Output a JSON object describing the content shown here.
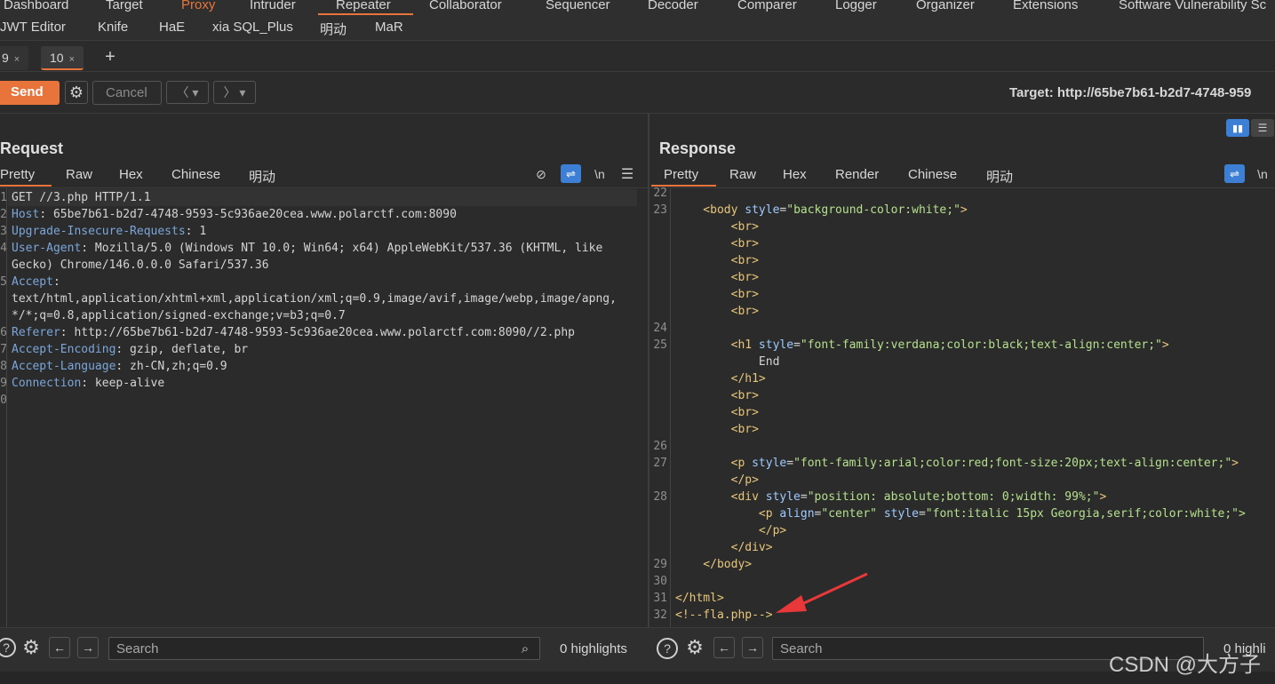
{
  "top_tabs": [
    "Dashboard",
    "Target",
    "Proxy",
    "Intruder",
    "Repeater",
    "Collaborator",
    "Sequencer",
    "Decoder",
    "Comparer",
    "Logger",
    "Organizer",
    "Extensions",
    "Software Vulnerability Sc"
  ],
  "ext_tabs": [
    "JWT Editor",
    "Knife",
    "HaE",
    "xia SQL_Plus",
    "明动",
    "MaR"
  ],
  "repeater_tabs": [
    {
      "label": "9"
    },
    {
      "label": "10"
    }
  ],
  "toolbar": {
    "send": "Send",
    "cancel": "Cancel",
    "target": "Target: http://65be7b61-b2d7-4748-959"
  },
  "request": {
    "title": "Request",
    "tabs": [
      "Pretty",
      "Raw",
      "Hex",
      "Chinese",
      "明动"
    ],
    "lines": [
      {
        "n": "1",
        "parts": [
          {
            "t": "GET //3.php HTTP/1.1",
            "c": "txt"
          }
        ]
      },
      {
        "n": "2",
        "parts": [
          {
            "t": "Host",
            "c": "k"
          },
          {
            "t": ": 65be7b61-b2d7-4748-9593-5c936ae20cea.www.polarctf.com:8090",
            "c": "txt"
          }
        ]
      },
      {
        "n": "3",
        "parts": [
          {
            "t": "Upgrade-Insecure-Requests",
            "c": "k"
          },
          {
            "t": ": 1",
            "c": "txt"
          }
        ]
      },
      {
        "n": "4",
        "parts": [
          {
            "t": "User-Agent",
            "c": "k"
          },
          {
            "t": ": Mozilla/5.0 (Windows NT 10.0; Win64; x64) AppleWebKit/537.36 (KHTML, like",
            "c": "txt"
          }
        ]
      },
      {
        "n": "",
        "parts": [
          {
            "t": "Gecko) Chrome/146.0.0.0 Safari/537.36",
            "c": "txt"
          }
        ]
      },
      {
        "n": "5",
        "parts": [
          {
            "t": "Accept",
            "c": "k"
          },
          {
            "t": ":",
            "c": "txt"
          }
        ]
      },
      {
        "n": "",
        "parts": [
          {
            "t": "text/html,application/xhtml+xml,application/xml;q=0.9,image/avif,image/webp,image/apng,",
            "c": "txt"
          }
        ]
      },
      {
        "n": "",
        "parts": [
          {
            "t": "*/*;q=0.8,application/signed-exchange;v=b3;q=0.7",
            "c": "txt"
          }
        ]
      },
      {
        "n": "6",
        "parts": [
          {
            "t": "Referer",
            "c": "k"
          },
          {
            "t": ": http://65be7b61-b2d7-4748-9593-5c936ae20cea.www.polarctf.com:8090//2.php",
            "c": "txt"
          }
        ]
      },
      {
        "n": "7",
        "parts": [
          {
            "t": "Accept-Encoding",
            "c": "k"
          },
          {
            "t": ": gzip, deflate, br",
            "c": "txt"
          }
        ]
      },
      {
        "n": "8",
        "parts": [
          {
            "t": "Accept-Language",
            "c": "k"
          },
          {
            "t": ": zh-CN,zh;q=0.9",
            "c": "txt"
          }
        ]
      },
      {
        "n": "9",
        "parts": [
          {
            "t": "Connection",
            "c": "k"
          },
          {
            "t": ": keep-alive",
            "c": "txt"
          }
        ]
      },
      {
        "n": "10",
        "parts": []
      }
    ]
  },
  "response": {
    "title": "Response",
    "tabs": [
      "Pretty",
      "Raw",
      "Hex",
      "Render",
      "Chinese",
      "明动"
    ],
    "lines": [
      {
        "n": "22",
        "parts": []
      },
      {
        "n": "23",
        "parts": [
          {
            "t": "    <body ",
            "c": "tag"
          },
          {
            "t": "style",
            "c": "attr"
          },
          {
            "t": "=",
            "c": "txt"
          },
          {
            "t": "\"background-color:white;\"",
            "c": "sval"
          },
          {
            "t": ">",
            "c": "tag"
          }
        ]
      },
      {
        "n": "",
        "parts": [
          {
            "t": "        <br>",
            "c": "tag"
          }
        ]
      },
      {
        "n": "",
        "parts": [
          {
            "t": "        <br>",
            "c": "tag"
          }
        ]
      },
      {
        "n": "",
        "parts": [
          {
            "t": "        <br>",
            "c": "tag"
          }
        ]
      },
      {
        "n": "",
        "parts": [
          {
            "t": "        <br>",
            "c": "tag"
          }
        ]
      },
      {
        "n": "",
        "parts": [
          {
            "t": "        <br>",
            "c": "tag"
          }
        ]
      },
      {
        "n": "",
        "parts": [
          {
            "t": "        <br>",
            "c": "tag"
          }
        ]
      },
      {
        "n": "24",
        "parts": []
      },
      {
        "n": "25",
        "parts": [
          {
            "t": "        <h1 ",
            "c": "tag"
          },
          {
            "t": "style",
            "c": "attr"
          },
          {
            "t": "=",
            "c": "txt"
          },
          {
            "t": "\"font-family:verdana;color:black;text-align:center;\"",
            "c": "sval"
          },
          {
            "t": ">",
            "c": "tag"
          }
        ]
      },
      {
        "n": "",
        "parts": [
          {
            "t": "            End",
            "c": "txt"
          }
        ]
      },
      {
        "n": "",
        "parts": [
          {
            "t": "        </h1>",
            "c": "tag"
          }
        ]
      },
      {
        "n": "",
        "parts": [
          {
            "t": "        <br>",
            "c": "tag"
          }
        ]
      },
      {
        "n": "",
        "parts": [
          {
            "t": "        <br>",
            "c": "tag"
          }
        ]
      },
      {
        "n": "",
        "parts": [
          {
            "t": "        <br>",
            "c": "tag"
          }
        ]
      },
      {
        "n": "26",
        "parts": []
      },
      {
        "n": "27",
        "parts": [
          {
            "t": "        <p ",
            "c": "tag"
          },
          {
            "t": "style",
            "c": "attr"
          },
          {
            "t": "=",
            "c": "txt"
          },
          {
            "t": "\"font-family:arial;color:red;font-size:20px;text-align:center;\"",
            "c": "sval"
          },
          {
            "t": ">",
            "c": "tag"
          }
        ]
      },
      {
        "n": "",
        "parts": [
          {
            "t": "        </p>",
            "c": "tag"
          }
        ]
      },
      {
        "n": "28",
        "parts": [
          {
            "t": "        <div ",
            "c": "tag"
          },
          {
            "t": "style",
            "c": "attr"
          },
          {
            "t": "=",
            "c": "txt"
          },
          {
            "t": "\"position: absolute;bottom: 0;width: 99%;\"",
            "c": "sval"
          },
          {
            "t": ">",
            "c": "tag"
          }
        ]
      },
      {
        "n": "",
        "parts": [
          {
            "t": "            <p ",
            "c": "tag"
          },
          {
            "t": "align",
            "c": "attr"
          },
          {
            "t": "=",
            "c": "txt"
          },
          {
            "t": "\"center\" ",
            "c": "sval"
          },
          {
            "t": "style",
            "c": "attr"
          },
          {
            "t": "=",
            "c": "txt"
          },
          {
            "t": "\"font:italic 15px Georgia,serif;color:white;\">",
            "c": "sval"
          }
        ]
      },
      {
        "n": "",
        "parts": [
          {
            "t": "            </p>",
            "c": "tag"
          }
        ]
      },
      {
        "n": "",
        "parts": [
          {
            "t": "        </div>",
            "c": "tag"
          }
        ]
      },
      {
        "n": "29",
        "parts": [
          {
            "t": "    </body>",
            "c": "tag"
          }
        ]
      },
      {
        "n": "30",
        "parts": []
      },
      {
        "n": "31",
        "parts": [
          {
            "t": "</html>",
            "c": "tag"
          }
        ]
      },
      {
        "n": "32",
        "parts": [
          {
            "t": "<!--fla.php-->",
            "c": "tag"
          }
        ]
      }
    ]
  },
  "bottom": {
    "search_placeholder": "Search",
    "req_highlights": "0 highlights",
    "resp_highlights": "0 highli"
  },
  "watermark": "CSDN @大方子",
  "colors": {
    "accent": "#e8743b",
    "bg": "#2b2b2b",
    "panel": "#232323",
    "toolbar": "#333333"
  }
}
